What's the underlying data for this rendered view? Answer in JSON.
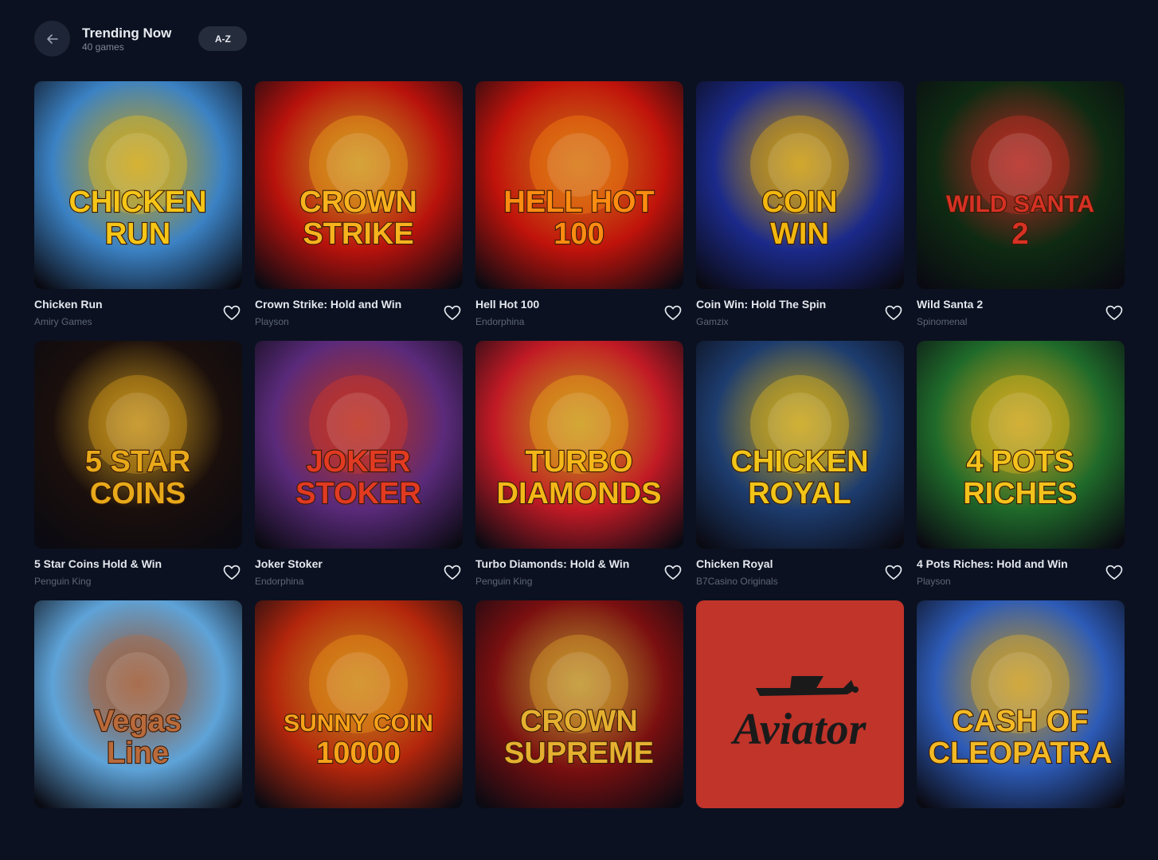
{
  "header": {
    "title": "Trending Now",
    "subtitle": "40 games",
    "sort_label": "A-Z"
  },
  "games": [
    {
      "name": "Chicken Run",
      "provider": "Amiry Games",
      "art": "CHICKEN RUN",
      "colors": [
        "#3b82c4",
        "#f5c517"
      ]
    },
    {
      "name": "Crown Strike: Hold and Win",
      "provider": "Playson",
      "art": "CROWN STRIKE",
      "colors": [
        "#b8120c",
        "#f7b21e"
      ]
    },
    {
      "name": "Hell Hot 100",
      "provider": "Endorphina",
      "art": "HELL HOT 100",
      "colors": [
        "#c0130b",
        "#ff8c12"
      ]
    },
    {
      "name": "Coin Win: Hold The Spin",
      "provider": "Gamzix",
      "art": "COIN WIN",
      "colors": [
        "#1b2a8a",
        "#f2b70f"
      ]
    },
    {
      "name": "Wild Santa 2",
      "provider": "Spinomenal",
      "art": "WILD SANTA 2",
      "colors": [
        "#0e2a12",
        "#d63124"
      ]
    },
    {
      "name": "5 Star Coins Hold & Win",
      "provider": "Penguin King",
      "art": "5 STAR COINS",
      "colors": [
        "#1a0f0c",
        "#e8a91a"
      ]
    },
    {
      "name": "Joker Stoker",
      "provider": "Endorphina",
      "art": "JOKER STOKER",
      "colors": [
        "#5a2a7a",
        "#e23a22"
      ]
    },
    {
      "name": "Turbo Diamonds: Hold & Win",
      "provider": "Penguin King",
      "art": "TURBO DIAMONDS",
      "colors": [
        "#c11a25",
        "#f4b719"
      ]
    },
    {
      "name": "Chicken Royal",
      "provider": "B7Casino Originals",
      "art": "CHICKEN ROYAL",
      "colors": [
        "#1d3c6e",
        "#f0c419"
      ]
    },
    {
      "name": "4 Pots Riches: Hold and Win",
      "provider": "Playson",
      "art": "4 POTS RICHES",
      "colors": [
        "#1f6a2a",
        "#f3c21c"
      ]
    },
    {
      "name": "",
      "provider": "",
      "art": "Vegas Line",
      "colors": [
        "#5ea3d8",
        "#b96a3b"
      ]
    },
    {
      "name": "",
      "provider": "",
      "art": "SUNNY COIN 10000",
      "colors": [
        "#b3260c",
        "#f7a21a"
      ]
    },
    {
      "name": "",
      "provider": "",
      "art": "CROWN SUPREME",
      "colors": [
        "#7a0f10",
        "#e5b030"
      ]
    },
    {
      "name": "",
      "provider": "",
      "art": "Aviator",
      "colors": [
        "#c0342a",
        "#1a1a1a"
      ]
    },
    {
      "name": "",
      "provider": "",
      "art": "CASH OF CLEOPATRA",
      "colors": [
        "#2d5bb7",
        "#f2b926"
      ]
    }
  ],
  "icons": {
    "back": "arrow-left-icon",
    "favorite": "heart-outline-icon"
  }
}
